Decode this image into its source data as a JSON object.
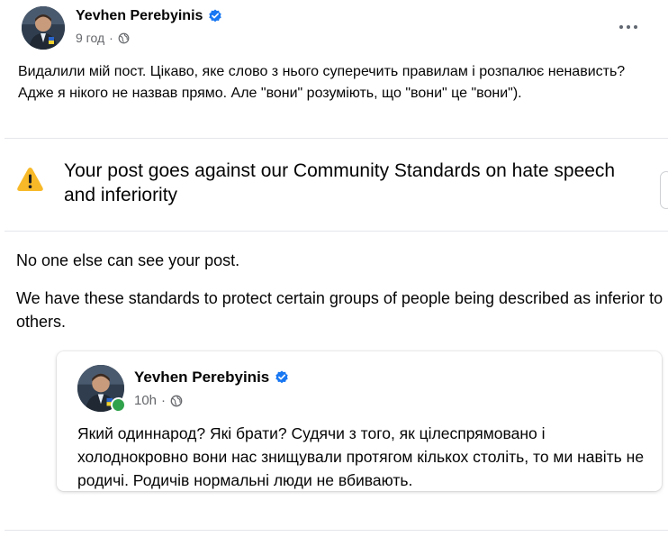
{
  "post": {
    "author": "Yevhen Perebyinis",
    "time": "9 год",
    "privacy_icon": "globe-icon",
    "text": "Видалили мій пост. Цікаво, яке слово з нього суперечить правилам і розпалює ненависть? Адже я нікого не назвав прямо. Але \"вони\" розуміють, що \"вони\" це \"вони\")."
  },
  "notice": {
    "icon": "warning-triangle-icon",
    "title": "Your post goes against our Community Standards on hate speech and inferiority",
    "visibility_text": "No one else can see your post.",
    "explanation": "We have these standards to protect certain groups of people being described as inferior to others."
  },
  "original_post": {
    "author": "Yevhen Perebyinis",
    "time": "10h",
    "privacy_icon": "globe-icon",
    "text": "Який одиннарод? Які брати? Судячи з того, як цілеспрямовано і холоднокровно вони нас знищували протягом кількох століть, то ми навіть не родичі. Родичів нормальні люди не вбивають."
  },
  "colors": {
    "verified_blue": "#1877f2",
    "warning_yellow": "#f7b928",
    "online_green": "#31a24c",
    "secondary_text": "#65676b"
  }
}
